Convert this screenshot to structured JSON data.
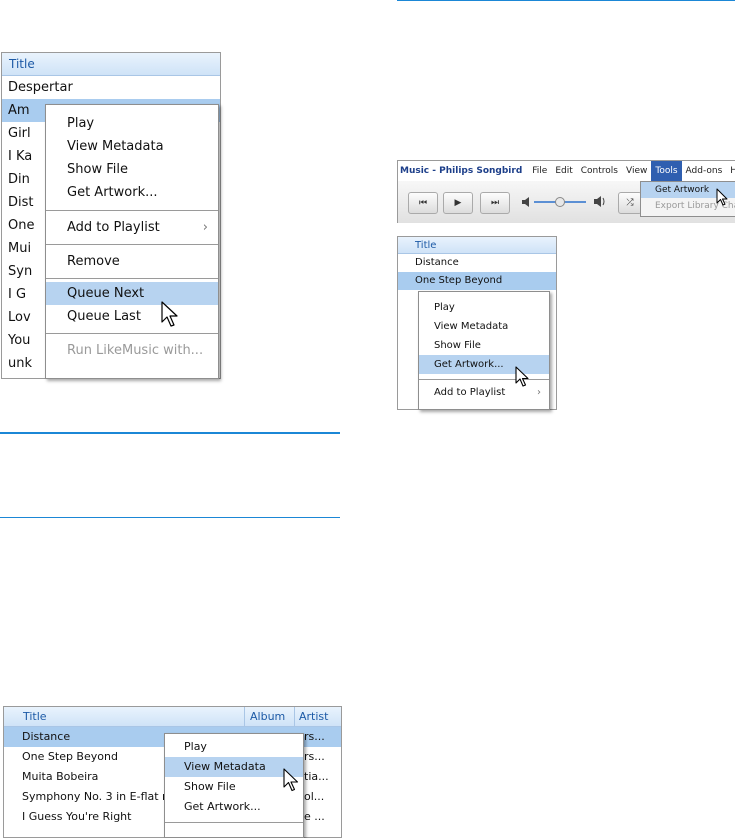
{
  "panel1": {
    "header": "Title",
    "rows": [
      "Despertar",
      "Am",
      "Girl",
      "I Ka",
      "Din",
      "Dist",
      "One",
      "Mui",
      "Syn",
      "I G",
      "Lov",
      "You",
      "unk"
    ],
    "menu": {
      "items": [
        "Play",
        "View Metadata",
        "Show File",
        "Get Artwork..."
      ],
      "playlist": "Add to Playlist",
      "remove": "Remove",
      "queue_next": "Queue Next",
      "queue_last": "Queue Last",
      "run": "Run LikeMusic with..."
    }
  },
  "toolbar": {
    "app_title": "Music - Philips Songbird",
    "menus": [
      "File",
      "Edit",
      "Controls",
      "View",
      "Tools",
      "Add-ons",
      "Help"
    ],
    "tools_menu": {
      "get_artwork": "Get Artwork",
      "export": "Export Library Cha"
    },
    "buttons": {
      "prev": "⏮",
      "play": "▶",
      "next": "⏭",
      "shuffle": "⤮"
    }
  },
  "panel2": {
    "header": "Title",
    "rows": [
      "Distance",
      "One Step Beyond"
    ],
    "menu": {
      "items": [
        "Play",
        "View Metadata",
        "Show File",
        "Get Artwork..."
      ],
      "playlist": "Add to Playlist"
    }
  },
  "panel3": {
    "headers": {
      "title": "Title",
      "album": "Album",
      "artist": "Artist"
    },
    "rows": [
      {
        "title": "Distance",
        "tail": "rs..."
      },
      {
        "title": "One Step Beyond",
        "tail": "rs..."
      },
      {
        "title": "Muita Bobeira",
        "tail": "tia..."
      },
      {
        "title": "Symphony No. 3 in E-flat m",
        "tail": "ol..."
      },
      {
        "title": "I Guess You're Right",
        "tail": "e ..."
      }
    ],
    "menu": {
      "items": [
        "Play",
        "View Metadata",
        "Show File",
        "Get Artwork..."
      ]
    }
  },
  "colors": {
    "accent": "#1b87d6",
    "selection": "#a9ccef",
    "menu_highlight": "#b7d3f0"
  }
}
